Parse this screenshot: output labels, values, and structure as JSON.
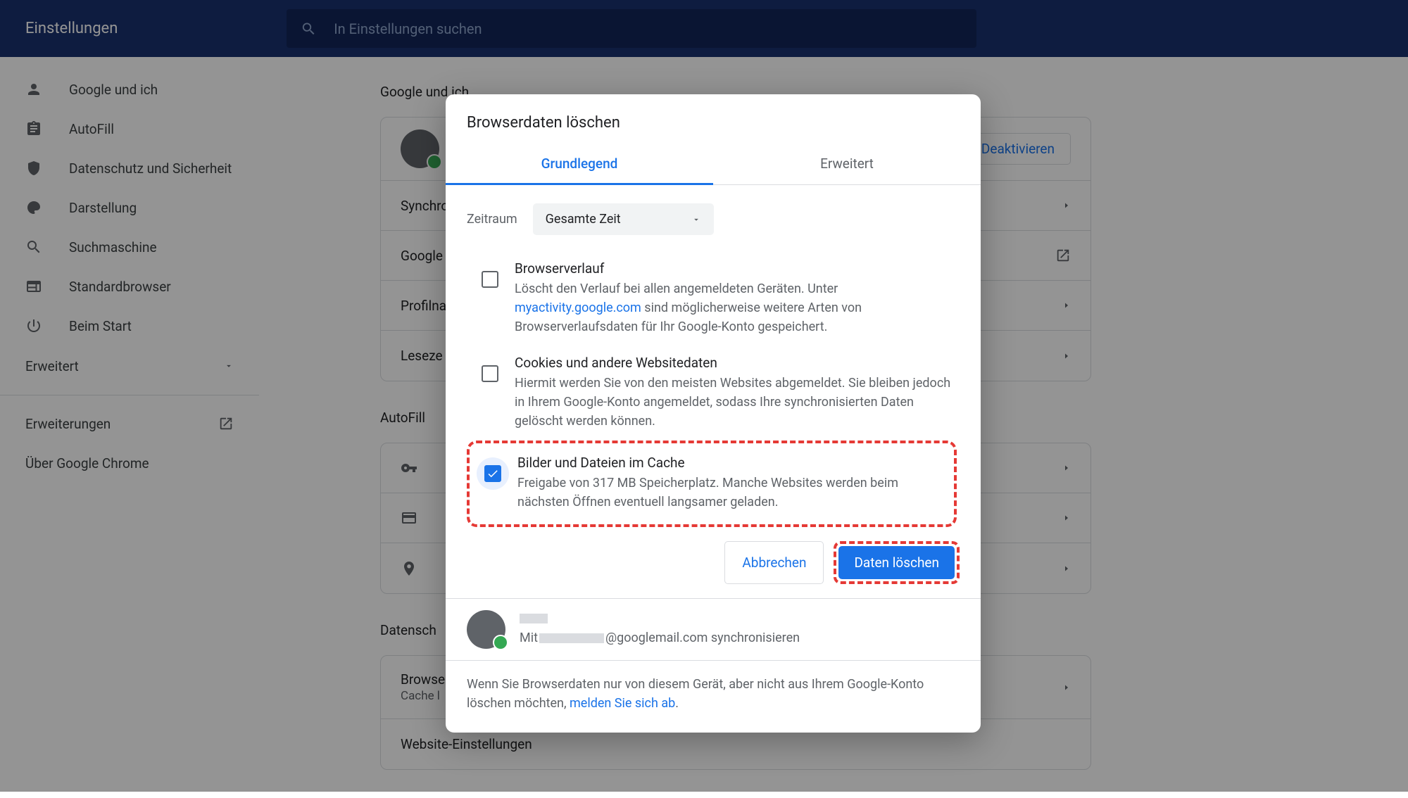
{
  "header": {
    "title": "Einstellungen",
    "search_placeholder": "In Einstellungen suchen"
  },
  "sidebar": {
    "items": [
      {
        "label": "Google und ich"
      },
      {
        "label": "AutoFill"
      },
      {
        "label": "Datenschutz und Sicherheit"
      },
      {
        "label": "Darstellung"
      },
      {
        "label": "Suchmaschine"
      },
      {
        "label": "Standardbrowser"
      },
      {
        "label": "Beim Start"
      }
    ],
    "advanced": "Erweitert",
    "extensions": "Erweiterungen",
    "about": "Über Google Chrome"
  },
  "main": {
    "section1": "Google und ich",
    "deactivate": "Deaktivieren",
    "rows1": [
      "Synchro",
      "Google",
      "Profilna",
      "Leseze"
    ],
    "section2": "AutoFill",
    "section3": "Datensch",
    "row_browse_title": "Browse",
    "row_browse_sub": "Cache l",
    "row_website": "Website-Einstellungen"
  },
  "dialog": {
    "title": "Browserdaten löschen",
    "tab_basic": "Grundlegend",
    "tab_advanced": "Erweitert",
    "period_label": "Zeitraum",
    "period_value": "Gesamte Zeit",
    "checks": [
      {
        "title": "Browserverlauf",
        "desc_pre": "Löscht den Verlauf bei allen angemeldeten Geräten. Unter ",
        "link": "myactivity.google.com",
        "desc_post": " sind möglicherweise weitere Arten von Browserverlaufsdaten für Ihr Google-Konto gespeichert."
      },
      {
        "title": "Cookies und andere Websitedaten",
        "desc": "Hiermit werden Sie von den meisten Websites abgemeldet. Sie bleiben jedoch in Ihrem Google-Konto angemeldet, sodass Ihre synchronisierten Daten gelöscht werden können."
      },
      {
        "title": "Bilder und Dateien im Cache",
        "desc": "Freigabe von 317 MB Speicherplatz. Manche Websites werden beim nächsten Öffnen eventuell langsamer geladen."
      }
    ],
    "cancel": "Abbrechen",
    "confirm": "Daten löschen",
    "sync_pre": "Mit ",
    "sync_domain": "@googlemail.com synchronisieren",
    "footer_pre": "Wenn Sie Browserdaten nur von diesem Gerät, aber nicht aus Ihrem Google-Konto löschen möchten, ",
    "footer_link": "melden Sie sich ab",
    "footer_post": "."
  }
}
